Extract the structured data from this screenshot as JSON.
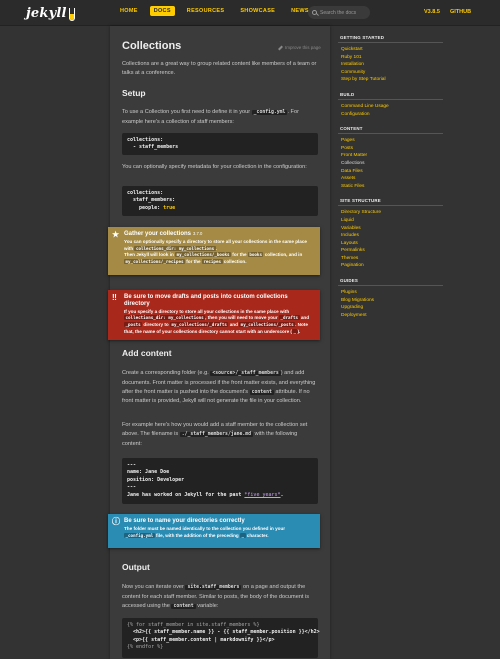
{
  "header": {
    "logo": "jekyll",
    "nav": [
      {
        "label": "HOME",
        "active": false
      },
      {
        "label": "DOCS",
        "active": true
      },
      {
        "label": "RESOURCES",
        "active": false
      },
      {
        "label": "SHOWCASE",
        "active": false
      },
      {
        "label": "NEWS",
        "active": false
      }
    ],
    "search_placeholder": "Search the docs",
    "version": "V3.8.5",
    "github": "GITHUB"
  },
  "content": {
    "title": "Collections",
    "improve_link": "Improve this page",
    "intro": "Collections are a great way to group related content like members of a team or talks at a conference.",
    "setup_heading": "Setup",
    "setup_p1_a": "To use a Collection you first need to define it in your ",
    "setup_p1_code": "_config.yml",
    "setup_p1_b": ". For example here's a collection of staff members:",
    "code1_l1": "collections:",
    "code1_l2": "  - staff_members",
    "setup_p2": "You can optionally specify metadata for your collection in the configuration:",
    "code2_l1": "collections:",
    "code2_l2": "  staff_members:",
    "code2_l3_key": "    people: ",
    "code2_l3_val": "true",
    "add_heading": "Add content",
    "add_p1_a": "Create a corresponding folder (e.g. ",
    "add_p1_code": "<source>/_staff_members",
    "add_p1_b": ") and add documents. Front matter is processed if the front matter exists, and everything after the front matter is pushed into the document's ",
    "add_p1_code2": "content",
    "add_p1_c": " attribute. If no front matter is provided, Jekyll will not generate the file in your collection.",
    "add_p2_a": "For example here's how you would add a staff member to the collection set above. The filename is ",
    "add_p2_code": "./_staff_members/jane.md",
    "add_p2_b": " with the following content:",
    "code3_l1": "---",
    "code3_l2": "name: Jane Doe",
    "code3_l3": "position: Developer",
    "code3_l4": "---",
    "code3_l5_a": "Jane has worked on Jekyll for the past ",
    "code3_l5_b": "*five years*",
    "code3_l5_c": ".",
    "output_heading": "Output",
    "out_p1_a": "Now you can iterate over ",
    "out_p1_code": "site.staff_members",
    "out_p1_b": " on a page and output the content for each staff member. Similar to posts, the body of the document is accessed using the ",
    "out_p1_code2": "content",
    "out_p1_c": " variable:",
    "code4_l1": "{% for staff_member in site.staff_members %}",
    "code4_l2": "  <h2>{{ staff_member.name }} - {{ staff_member.position }}</h2>",
    "code4_l3": "  <p>{{ staff_member.content | markdownify }}</p>",
    "code4_l4": "{% endfor %}"
  },
  "callouts": {
    "gather": {
      "title": "Gather your collections",
      "version": "3.7.0",
      "t1": "You can optionally specify a directory to store all your collections in the same place with ",
      "c1": "collections_dir: my_collections",
      "t2": ".",
      "t3": "Then Jekyll will look in ",
      "c2": "my_collections/_books",
      "t4": " for the ",
      "c3": "books",
      "t5": " collection, and in ",
      "c4": "my_collections/_recipes",
      "t6": " for the ",
      "c5": "recipes",
      "t7": " collection."
    },
    "drafts": {
      "title": "Be sure to move drafts and posts into custom collections directory",
      "t1": "If you specify a directory to store all your collections in the same place with ",
      "c1": "collections_dir: my_collections",
      "t2": ", then you will need to move your ",
      "c2": "_drafts",
      "t3": " and ",
      "c3": "_posts",
      "t4": " directory to ",
      "c4": "my_collections/_drafts",
      "t5": " and ",
      "c5": "my_collections/_posts",
      "t6": ". Note that, the name of your collections directory cannot start with an underscore (",
      "c6": "_",
      "t7": ")."
    },
    "naming": {
      "title": "Be sure to name your directories correctly",
      "t1": "The folder must be named identically to the collection you defined in your ",
      "c1": "_config.yml",
      "t2": " file, with the addition of the preceding ",
      "c2": "_",
      "t3": " character."
    }
  },
  "sidebar": {
    "sections": [
      {
        "heading": "GETTING STARTED",
        "items": [
          "Quickstart",
          "Ruby 101",
          "Installation",
          "Community",
          "Step by Step Tutorial"
        ]
      },
      {
        "heading": "BUILD",
        "items": [
          "Command Line Usage",
          "Configuration"
        ]
      },
      {
        "heading": "CONTENT",
        "items": [
          "Pages",
          "Posts",
          "Front Matter",
          "Collections",
          "Data Files",
          "Assets",
          "Static Files"
        ]
      },
      {
        "heading": "SITE STRUCTURE",
        "items": [
          "Directory Structure",
          "Liquid",
          "Variables",
          "Includes",
          "Layouts",
          "Permalinks",
          "Themes",
          "Pagination"
        ]
      },
      {
        "heading": "GUIDES",
        "items": [
          "Plugins",
          "Blog Migrations",
          "Upgrading",
          "Deployment"
        ]
      }
    ],
    "active_item": "Collections"
  },
  "colors": {
    "accent": "#fc0",
    "background": "#333333",
    "panel": "#3b3b3b",
    "callout_yellow": "#a48a44",
    "callout_red": "#a8281c",
    "callout_blue": "#2a8bb3"
  }
}
